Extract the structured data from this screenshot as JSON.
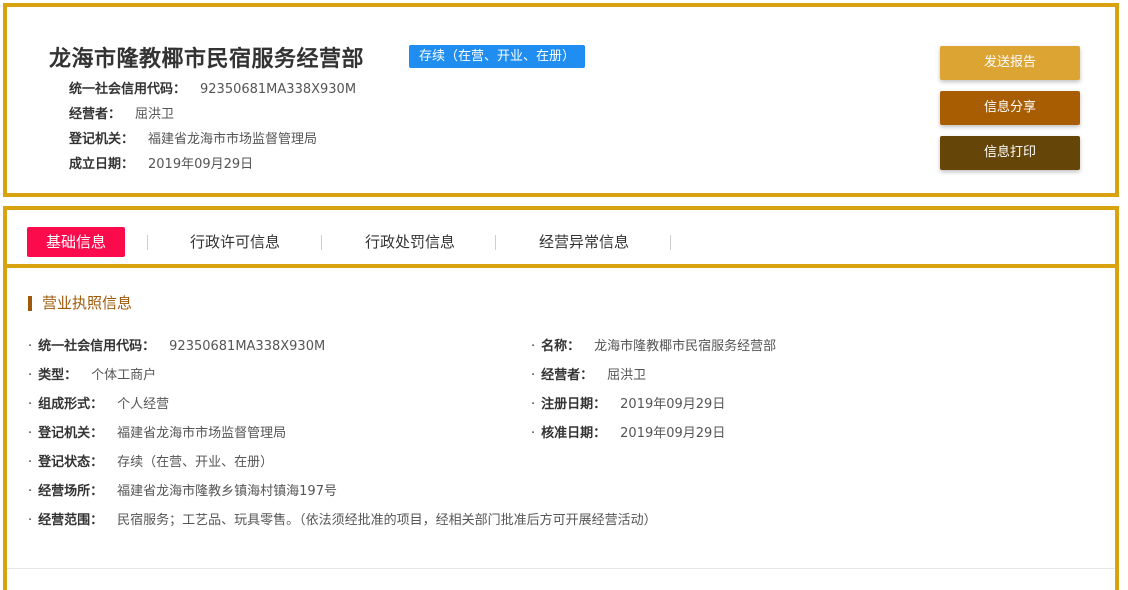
{
  "header": {
    "company_name": "龙海市隆教椰市民宿服务经营部",
    "status_badge": "存续（在营、开业、在册）",
    "info": [
      {
        "label": "统一社会信用代码：",
        "value": "92350681MA338X930M"
      },
      {
        "label": "经营者：",
        "value": "屈洪卫"
      },
      {
        "label": "登记机关：",
        "value": "福建省龙海市市场监督管理局"
      },
      {
        "label": "成立日期：",
        "value": "2019年09月29日"
      }
    ],
    "buttons": {
      "report": "发送报告",
      "share": "信息分享",
      "print": "信息打印"
    }
  },
  "tabs": [
    {
      "label": "基础信息",
      "active": true
    },
    {
      "label": "行政许可信息",
      "active": false
    },
    {
      "label": "行政处罚信息",
      "active": false
    },
    {
      "label": "经营异常信息",
      "active": false
    }
  ],
  "section": {
    "title": "营业执照信息",
    "bullet": "·",
    "left_fields": [
      {
        "label": "统一社会信用代码：",
        "value": "92350681MA338X930M"
      },
      {
        "label": "类型：",
        "value": "个体工商户"
      },
      {
        "label": "组成形式：",
        "value": "个人经营"
      },
      {
        "label": "登记机关：",
        "value": "福建省龙海市市场监督管理局"
      },
      {
        "label": "登记状态：",
        "value": "存续（在营、开业、在册）"
      },
      {
        "label": "经营场所：",
        "value": "福建省龙海市隆教乡镇海村镇海197号"
      },
      {
        "label": "经营范围：",
        "value": "民宿服务；工艺品、玩具零售。（依法须经批准的项目，经相关部门批准后方可开展经营活动）"
      }
    ],
    "right_fields": [
      {
        "label": "名称：",
        "value": "龙海市隆教椰市民宿服务经营部"
      },
      {
        "label": "经营者：",
        "value": "屈洪卫"
      },
      {
        "label": "注册日期：",
        "value": "2019年09月29日"
      },
      {
        "label": "核准日期：",
        "value": "2019年09月29日"
      }
    ]
  },
  "colors": {
    "border": "#d8a30e",
    "badge": "#1f8ef0",
    "active_tab": "#fb0b4c",
    "btn_report": "#dca433",
    "btn_share": "#a85d02",
    "btn_print": "#664508",
    "section_title": "#9e5a0a"
  }
}
